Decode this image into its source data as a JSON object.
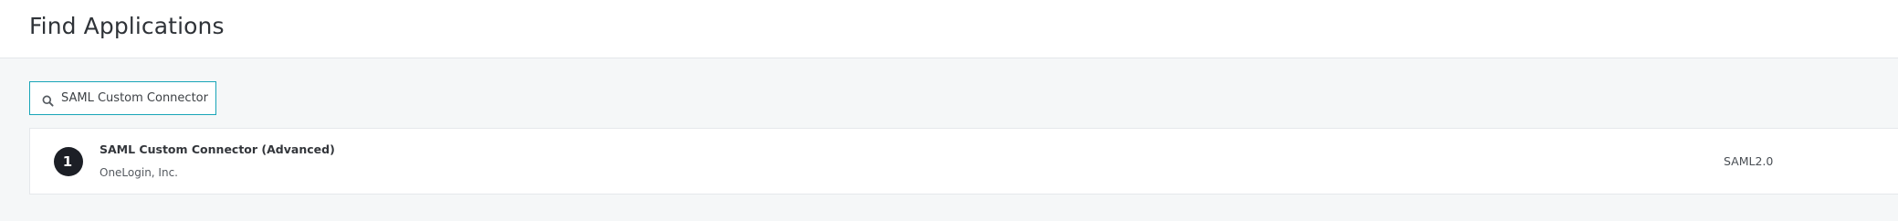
{
  "header": {
    "title": "Find Applications"
  },
  "search": {
    "value": "SAML Custom Connector",
    "icon": "search-icon"
  },
  "results": [
    {
      "name": "SAML Custom Connector (Advanced)",
      "vendor": "OneLogin, Inc.",
      "protocol": "SAML2.0",
      "logo_glyph": "1",
      "logo_icon": "onelogin-logo-icon"
    }
  ],
  "colors": {
    "accent": "#18a5b8",
    "background": "#f5f7f8",
    "card": "#ffffff",
    "logo_bg": "#1c1f26"
  }
}
